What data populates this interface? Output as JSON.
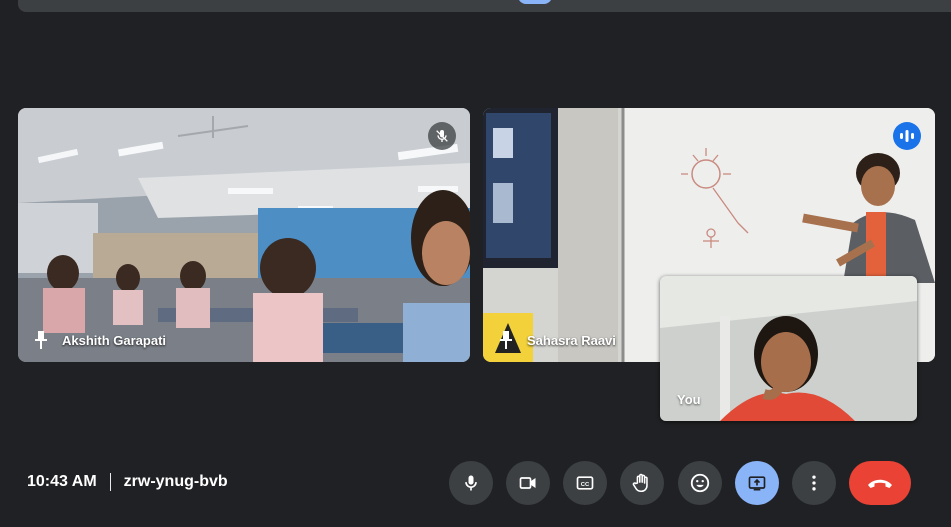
{
  "participants": [
    {
      "name": "Akshith Garapati",
      "muted": true
    },
    {
      "name": "Sahasra Raavi",
      "speaking": true
    }
  ],
  "self_view": {
    "label": "You"
  },
  "meeting": {
    "time": "10:43 AM",
    "code": "zrw-ynug-bvb"
  },
  "controls": [
    {
      "name": "microphone-icon",
      "active": false
    },
    {
      "name": "camera-icon",
      "active": false
    },
    {
      "name": "captions-icon",
      "active": false
    },
    {
      "name": "raise-hand-icon",
      "active": false
    },
    {
      "name": "emoji-icon",
      "active": false
    },
    {
      "name": "present-screen-icon",
      "active": true
    },
    {
      "name": "more-options-icon",
      "active": false
    },
    {
      "name": "end-call-icon",
      "active": false
    }
  ],
  "colors": {
    "background": "#202124",
    "control": "#3c4043",
    "accent": "#8ab4f8",
    "end_call": "#ea4335",
    "speaking": "#1a73e8"
  }
}
